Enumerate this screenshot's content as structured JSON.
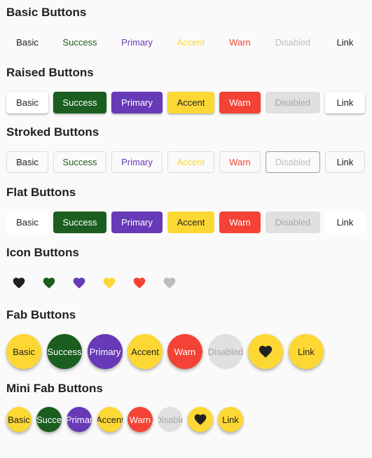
{
  "sections": {
    "basic": "Basic Buttons",
    "raised": "Raised Buttons",
    "stroked": "Stroked Buttons",
    "flat": "Flat Buttons",
    "icon": "Icon Buttons",
    "fab": "Fab Buttons",
    "mini_fab": "Mini Fab Buttons"
  },
  "labels": {
    "basic": "Basic",
    "success": "Success",
    "primary": "Primary",
    "accent": "Accent",
    "warn": "Warn",
    "disabled": "Disabled",
    "link": "Link"
  },
  "mini_labels": {
    "basic": "Basic",
    "success": "Succe",
    "primary": "Primar",
    "accent": "Accent",
    "warn": "Warn",
    "disabled": "Disable",
    "link": "Link"
  },
  "icon_buttons": [
    {
      "name": "basic",
      "icon": "heart-icon",
      "color": "#212121"
    },
    {
      "name": "success",
      "icon": "heart-icon",
      "color": "#1b5e20"
    },
    {
      "name": "primary",
      "icon": "heart-icon",
      "color": "#673ab7"
    },
    {
      "name": "accent",
      "icon": "heart-icon",
      "color": "#fdd835"
    },
    {
      "name": "warn",
      "icon": "heart-icon",
      "color": "#f44336"
    },
    {
      "name": "disabled",
      "icon": "heart-icon",
      "color": "#bdbdbd"
    }
  ],
  "colors": {
    "success": "#1b5e20",
    "primary": "#673ab7",
    "accent": "#fdd835",
    "warn": "#f44336",
    "disabled_bg": "#e0e0e0",
    "disabled_text": "#bdbdbd"
  }
}
